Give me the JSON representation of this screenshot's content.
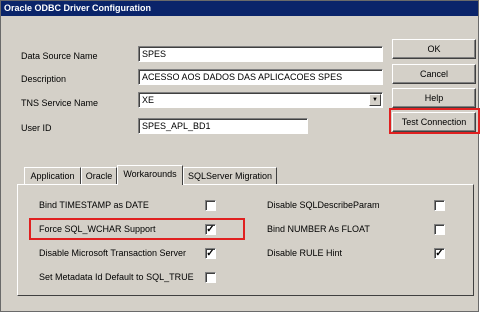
{
  "window": {
    "title": "Oracle ODBC Driver Configuration"
  },
  "form": {
    "data_source_label": "Data Source Name",
    "data_source_value": "SPES",
    "description_label": "Description",
    "description_value": "ACESSO AOS DADOS DAS APLICACOES SPES",
    "tns_label": "TNS Service Name",
    "tns_value": "XE",
    "userid_label": "User ID",
    "userid_value": "SPES_APL_BD1"
  },
  "buttons": {
    "ok": "OK",
    "cancel": "Cancel",
    "help": "Help",
    "test_connection": "Test Connection"
  },
  "tabs": [
    {
      "label": "Application"
    },
    {
      "label": "Oracle"
    },
    {
      "label": "Workarounds",
      "active": true
    },
    {
      "label": "SQLServer Migration"
    }
  ],
  "workarounds": {
    "options": [
      {
        "label": "Bind TIMESTAMP as DATE",
        "checked": false
      },
      {
        "label": "Force SQL_WCHAR Support",
        "checked": true
      },
      {
        "label": "Disable Microsoft Transaction Server",
        "checked": true
      },
      {
        "label": "Set Metadata Id Default to SQL_TRUE",
        "checked": false
      },
      {
        "label": "Disable SQLDescribeParam",
        "checked": false
      },
      {
        "label": "Bind NUMBER As FLOAT",
        "checked": false
      },
      {
        "label": "Disable RULE Hint",
        "checked": true
      }
    ]
  },
  "colors": {
    "highlight": "#e02020",
    "titlebar": "#0a246a",
    "dialog": "#d4d0c8"
  },
  "icons": {
    "dropdown": "chevron-down-icon",
    "check": "checkmark-icon"
  }
}
